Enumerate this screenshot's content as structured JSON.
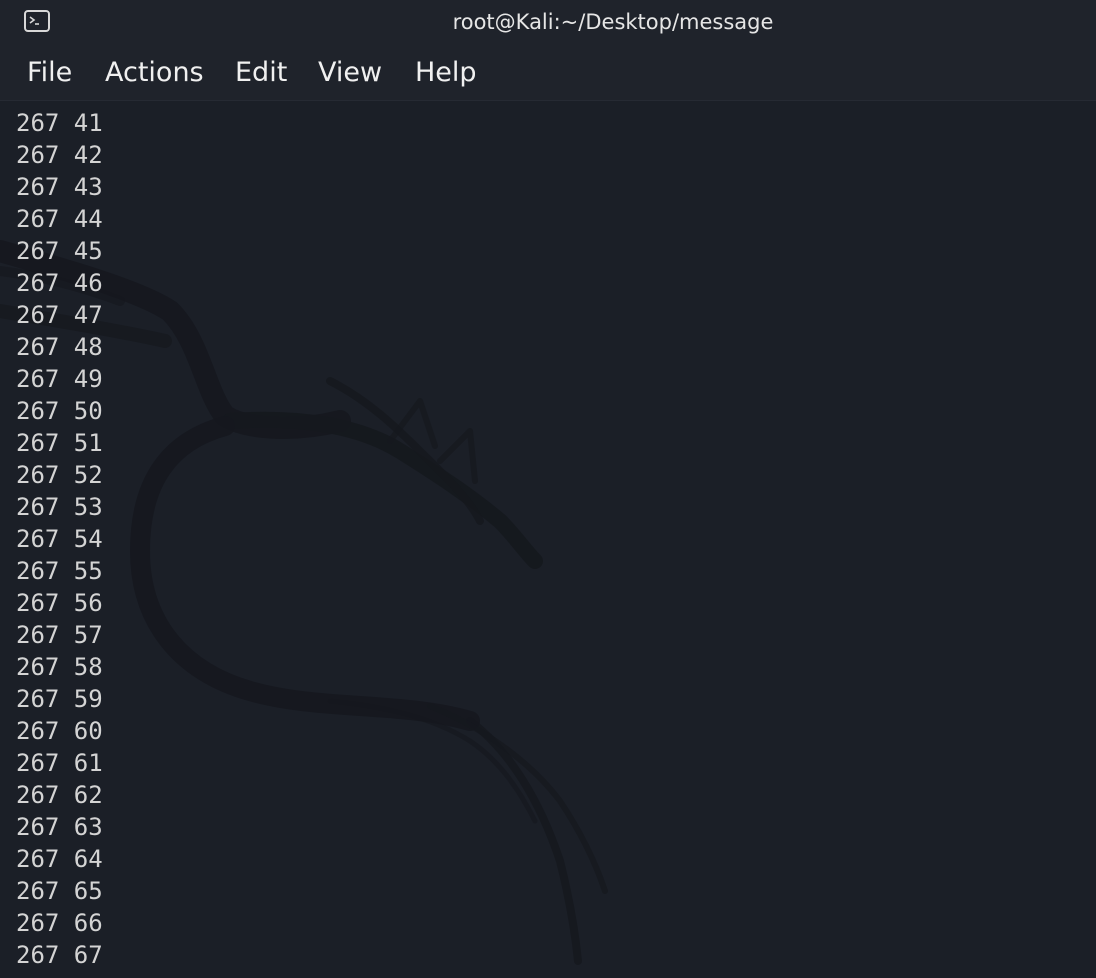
{
  "window": {
    "title": "root@Kali:~/Desktop/message",
    "icon": "terminal-icon"
  },
  "menu": [
    {
      "label": "File"
    },
    {
      "label": "Actions"
    },
    {
      "label": "Edit"
    },
    {
      "label": "View"
    },
    {
      "label": "Help"
    }
  ],
  "terminal": {
    "lines": [
      "267 41",
      "267 42",
      "267 43",
      "267 44",
      "267 45",
      "267 46",
      "267 47",
      "267 48",
      "267 49",
      "267 50",
      "267 51",
      "267 52",
      "267 53",
      "267 54",
      "267 55",
      "267 56",
      "267 57",
      "267 58",
      "267 59",
      "267 60",
      "267 61",
      "267 62",
      "267 63",
      "267 64",
      "267 65",
      "267 66",
      "267 67"
    ],
    "background_logo": "kali-dragon-watermark"
  },
  "colors": {
    "background": "#1b1f27",
    "titlebar": "#1f232b",
    "text": "#d4d4d4"
  }
}
